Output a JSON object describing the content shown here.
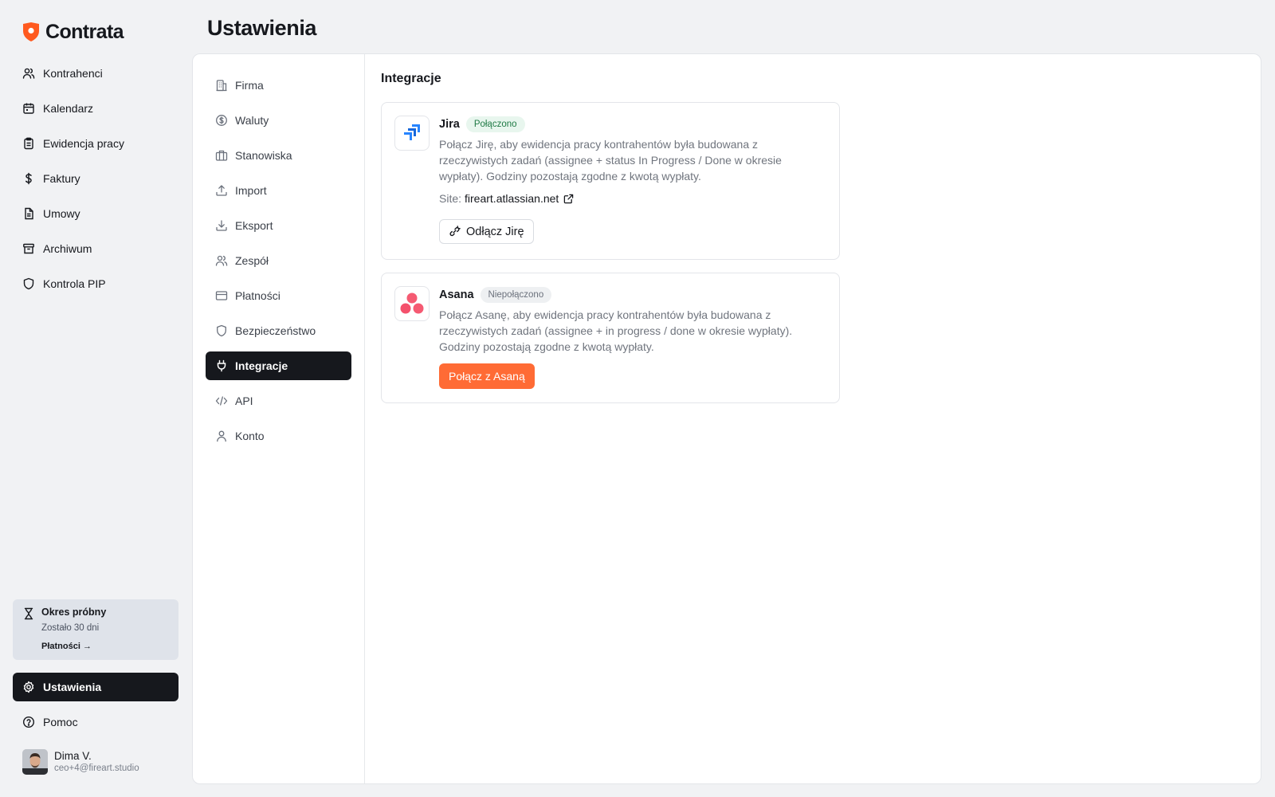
{
  "app": {
    "name": "Contrata",
    "brand_color": "#ff5a1f"
  },
  "sidebar": {
    "items": [
      {
        "label": "Kontrahenci",
        "icon": "users-icon"
      },
      {
        "label": "Kalendarz",
        "icon": "calendar-icon"
      },
      {
        "label": "Ewidencja pracy",
        "icon": "clipboard-icon"
      },
      {
        "label": "Faktury",
        "icon": "dollar-icon"
      },
      {
        "label": "Umowy",
        "icon": "document-icon"
      },
      {
        "label": "Archiwum",
        "icon": "archive-icon"
      },
      {
        "label": "Kontrola PIP",
        "icon": "shield-check-icon"
      }
    ],
    "trial": {
      "title": "Okres próbny",
      "subtitle": "Zostało 30 dni",
      "link": "Płatności →"
    },
    "settings_label": "Ustawienia",
    "help_label": "Pomoc",
    "user": {
      "name": "Dima V.",
      "email": "ceo+4@fireart.studio"
    }
  },
  "page": {
    "title": "Ustawienia"
  },
  "settings_nav": {
    "items": [
      {
        "label": "Firma",
        "icon": "building-icon"
      },
      {
        "label": "Waluty",
        "icon": "currency-icon"
      },
      {
        "label": "Stanowiska",
        "icon": "briefcase-icon"
      },
      {
        "label": "Import",
        "icon": "upload-icon"
      },
      {
        "label": "Eksport",
        "icon": "download-icon"
      },
      {
        "label": "Zespół",
        "icon": "team-icon"
      },
      {
        "label": "Płatności",
        "icon": "credit-card-icon"
      },
      {
        "label": "Bezpieczeństwo",
        "icon": "shield-icon"
      },
      {
        "label": "Integracje",
        "icon": "plug-icon"
      },
      {
        "label": "API",
        "icon": "code-icon"
      },
      {
        "label": "Konto",
        "icon": "user-icon"
      }
    ],
    "active": "Integracje"
  },
  "integrations": {
    "title": "Integracje",
    "jira": {
      "name": "Jira",
      "status": "Połączono",
      "description": "Połącz Jirę, aby ewidencja pracy kontrahentów była budowana z rzeczywistych zadań (assignee + status In Progress / Done w okresie wypłaty). Godziny pozostają zgodne z kwotą wypłaty.",
      "site_label": "Site:",
      "site_url": "fireart.atlassian.net",
      "disconnect_label": "Odłącz Jirę"
    },
    "asana": {
      "name": "Asana",
      "status": "Niepołączono",
      "description": "Połącz Asanę, aby ewidencja pracy kontrahentów była budowana z rzeczywistych zadań (assignee + in progress / done w okresie wypłaty). Godziny pozostają zgodne z kwotą wypłaty.",
      "connect_label": "Połącz z Asaną"
    }
  }
}
